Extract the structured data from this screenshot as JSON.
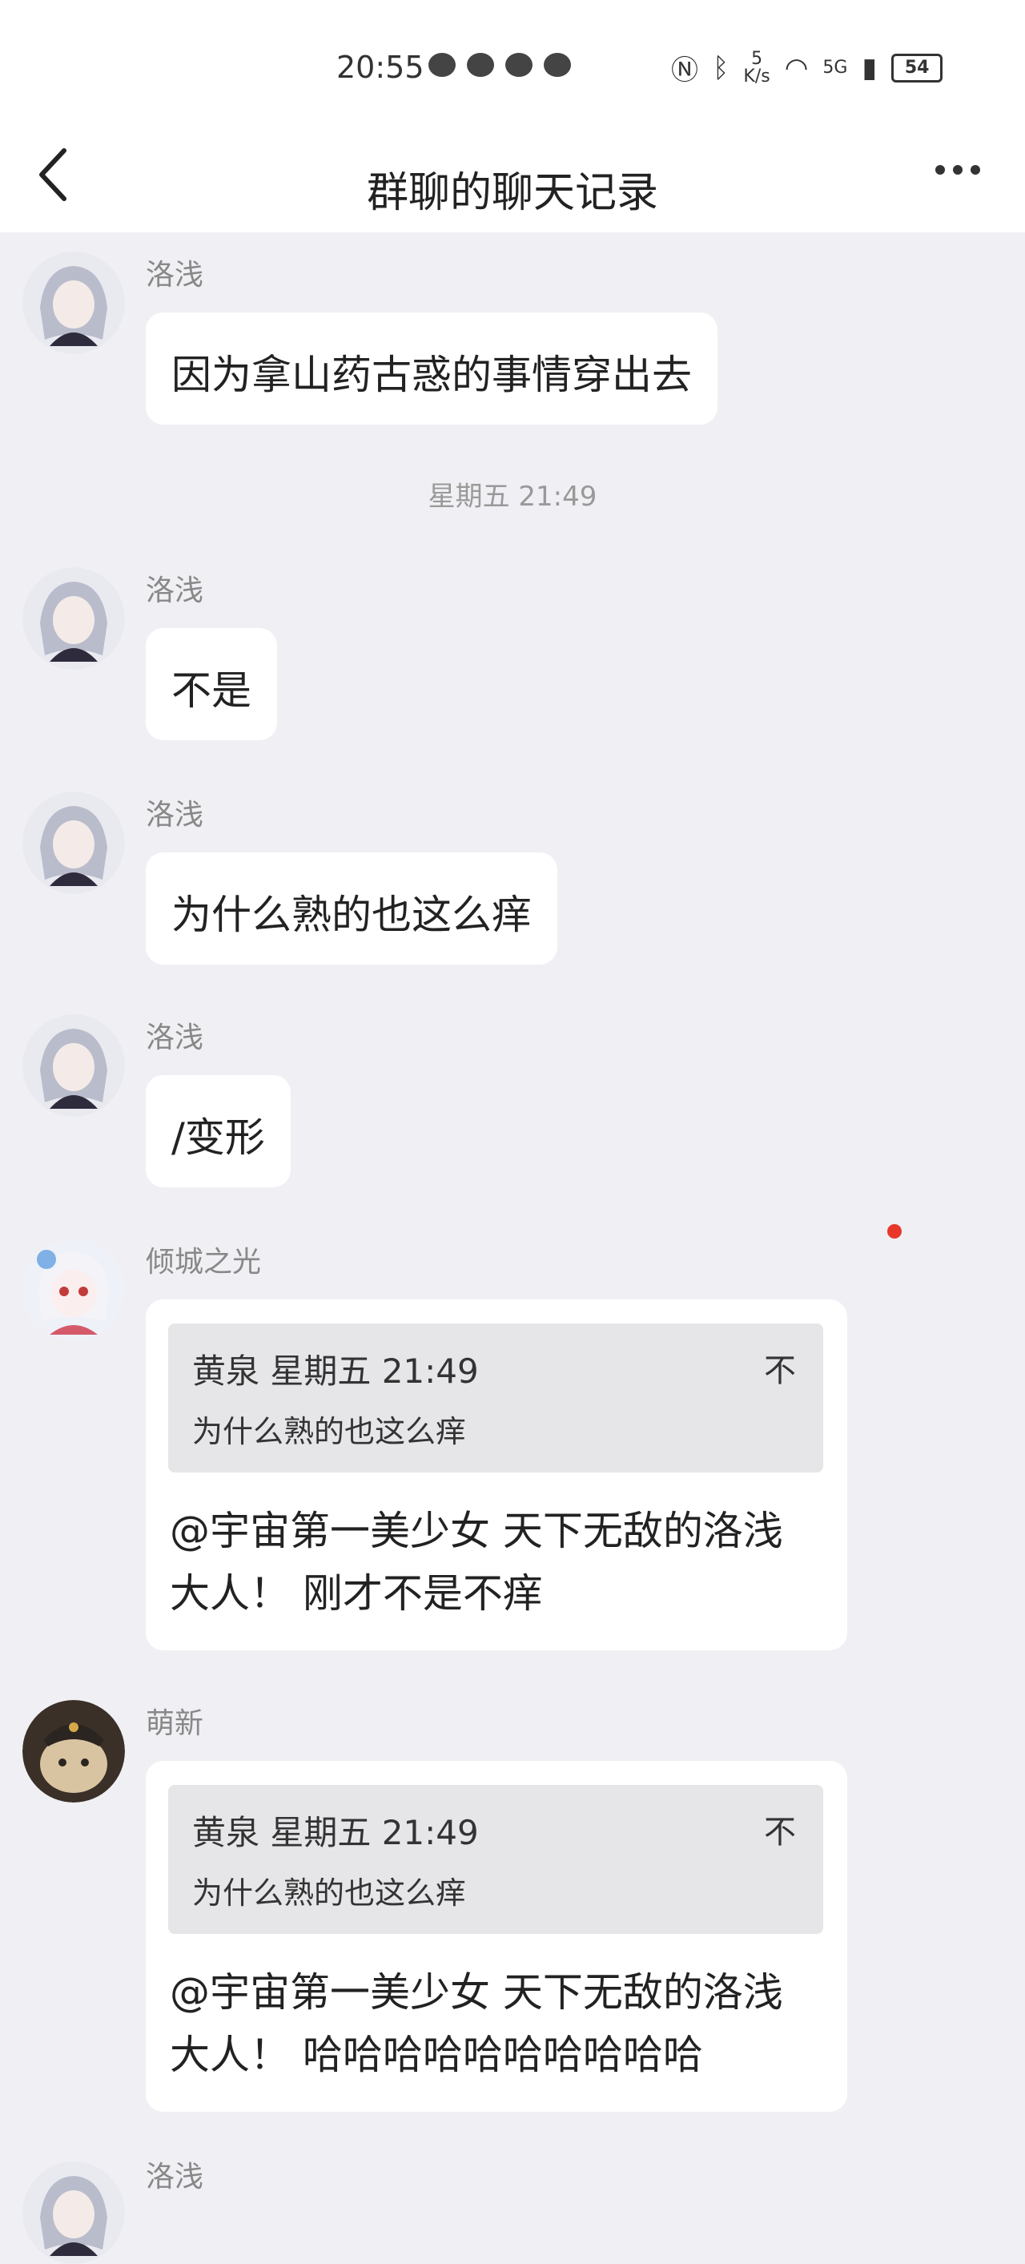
{
  "status_bar": {
    "time": "20:55",
    "net_speed_value": "5",
    "net_speed_unit": "K/s",
    "network": "5G",
    "battery": "54"
  },
  "header": {
    "title": "群聊的聊天记录"
  },
  "messages": [
    {
      "sender": "洛浅",
      "text": "因为拿山药古惑的事情穿出去"
    },
    {
      "sender": "洛浅",
      "text": "不是"
    },
    {
      "sender": "洛浅",
      "text": "为什么熟的也这么痒"
    },
    {
      "sender": "洛浅",
      "text": "/变形"
    },
    {
      "sender": "倾城之光",
      "quote_head": "黄泉 星期五 21:49",
      "quote_body": "为什么熟的也这么痒",
      "quote_jump": "不",
      "text_line1": "@宇宙第一美少女 天下无敌的洛浅",
      "text_line2": "大人！ 刚才不是不痒"
    },
    {
      "sender": "萌新",
      "quote_head": "黄泉 星期五 21:49",
      "quote_body": "为什么熟的也这么痒",
      "quote_jump": "不",
      "text_line1": "@宇宙第一美少女 天下无敌的洛浅",
      "text_line2": "大人！ 哈哈哈哈哈哈哈哈哈哈"
    },
    {
      "sender": "洛浅"
    }
  ],
  "timestamp": "星期五 21:49",
  "icons": {
    "back": "chevron-left-icon",
    "more": "more-dots-icon"
  },
  "colors": {
    "background": "#f0f0f4",
    "bubble": "#ffffff",
    "quote": "#e6e6e9",
    "unread_dot": "#e8372a"
  }
}
